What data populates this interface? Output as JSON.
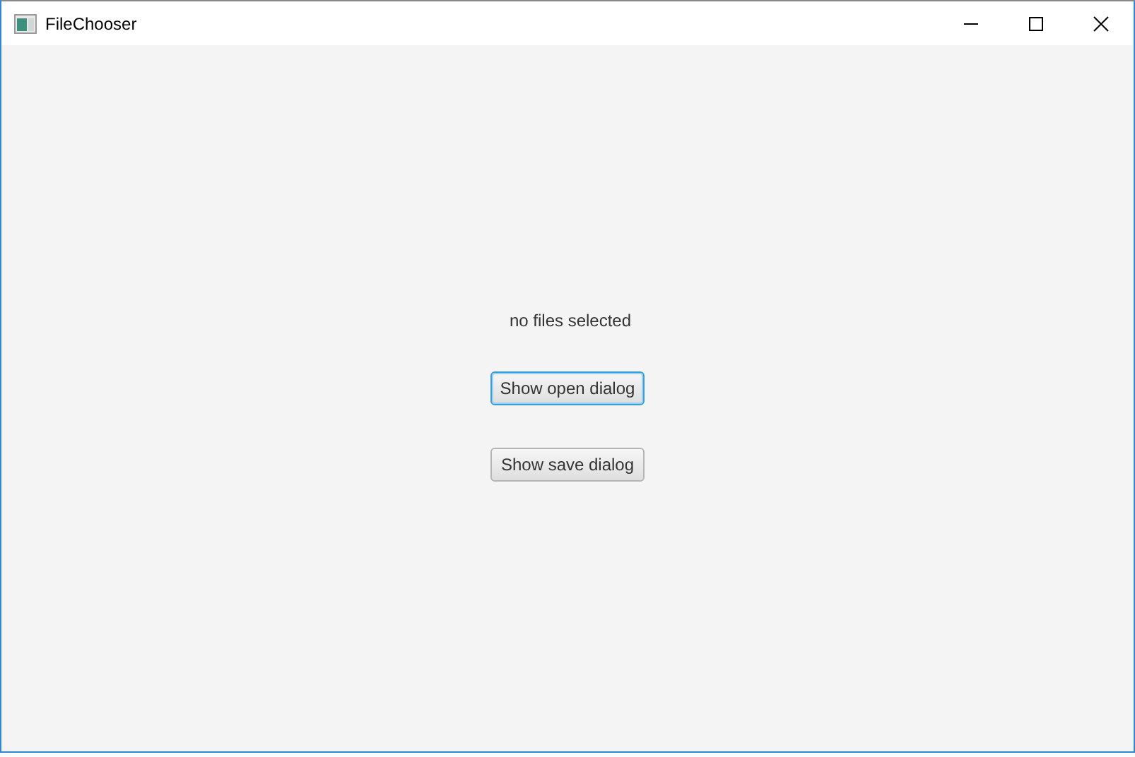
{
  "window": {
    "title": "FileChooser"
  },
  "status_label": "no files selected",
  "buttons": [
    {
      "label": "Show open dialog",
      "focused": true
    },
    {
      "label": "Show save dialog",
      "focused": false
    }
  ]
}
